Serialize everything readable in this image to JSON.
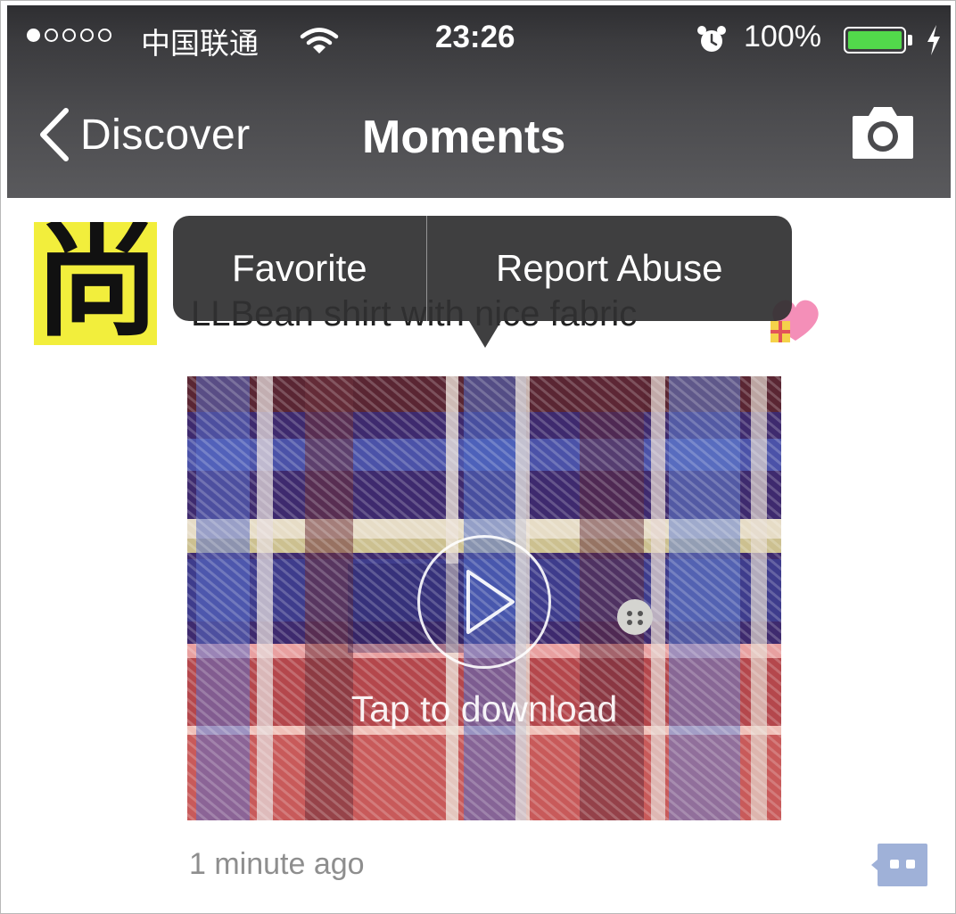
{
  "status_bar": {
    "carrier": "中国联通",
    "time": "23:26",
    "battery_percent": "100%",
    "battery_level": 1.0,
    "signal_bars": 1,
    "signal_total": 5,
    "icons": [
      "wifi-icon",
      "alarm-icon",
      "battery-icon",
      "charging-bolt-icon"
    ]
  },
  "nav": {
    "back_label": "Discover",
    "title": "Moments",
    "right_icon": "camera-icon"
  },
  "popup_menu": {
    "items": [
      {
        "label": "Favorite"
      },
      {
        "label": "Report Abuse"
      }
    ]
  },
  "post": {
    "avatar_text": "尚",
    "avatar_color": "#f2ee3c",
    "caption": "LLBean shirt with nice fabric",
    "caption_emoji": "gift-heart-icon",
    "video": {
      "hint": "Tap to download",
      "play_icon": "play-icon"
    },
    "timestamp": "1 minute ago",
    "action_icon": "comment-icon"
  },
  "colors": {
    "bar_dark": "#2e2e31",
    "bar_light": "#5a5a5d",
    "battery_green": "#52d94b",
    "comment_blue": "#9fb1d8",
    "timestamp_gray": "#8e8e8e"
  }
}
